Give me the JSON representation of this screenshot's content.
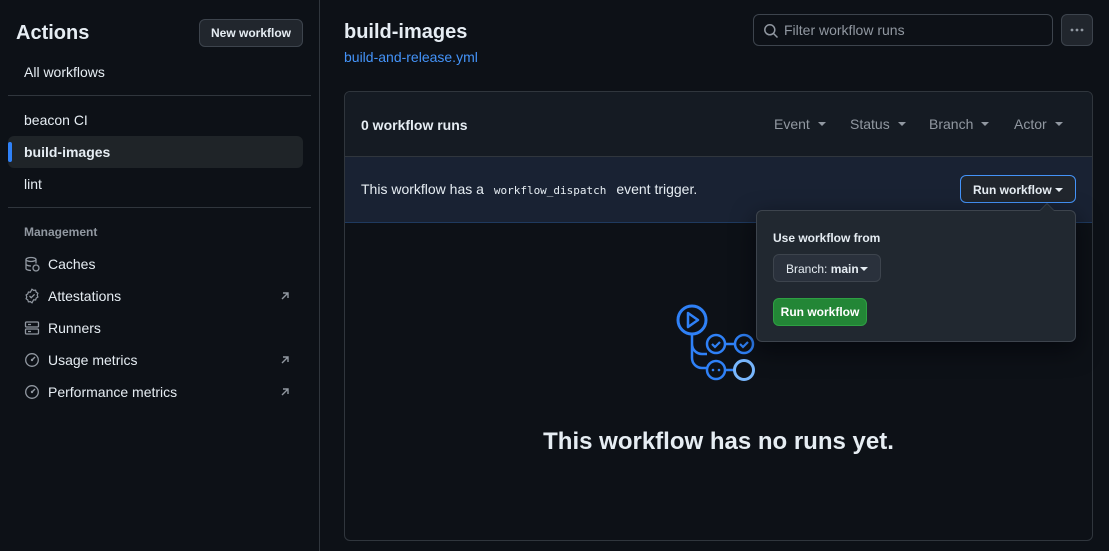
{
  "sidebar": {
    "title": "Actions",
    "new_workflow_label": "New workflow",
    "all_workflows_label": "All workflows",
    "workflows": [
      {
        "label": "beacon CI"
      },
      {
        "label": "build-images"
      },
      {
        "label": "lint"
      }
    ],
    "management_heading": "Management",
    "management_items": [
      {
        "label": "Caches",
        "icon": "database-icon"
      },
      {
        "label": "Attestations",
        "icon": "verified-icon",
        "external": true
      },
      {
        "label": "Runners",
        "icon": "server-icon"
      },
      {
        "label": "Usage metrics",
        "icon": "meter-icon",
        "external": true
      },
      {
        "label": "Performance metrics",
        "icon": "meter-icon",
        "external": true
      }
    ]
  },
  "header": {
    "workflow_title": "build-images",
    "workflow_file": "build-and-release.yml",
    "filter_placeholder": "Filter workflow runs"
  },
  "runs": {
    "count_label": "0 workflow runs",
    "filters": [
      "Event",
      "Status",
      "Branch",
      "Actor"
    ],
    "dispatch_text_before": "This workflow has a",
    "dispatch_code": "workflow_dispatch",
    "dispatch_text_after": "event trigger.",
    "run_workflow_label": "Run workflow",
    "empty_message": "This workflow has no runs yet."
  },
  "popover": {
    "use_from_label": "Use workflow from",
    "branch_prefix": "Branch:",
    "branch_value": "main",
    "run_button_label": "Run workflow"
  },
  "colors": {
    "accent": "#2f81f7",
    "link": "#4493f8",
    "primary_button": "#238636",
    "background": "#0d1117"
  }
}
